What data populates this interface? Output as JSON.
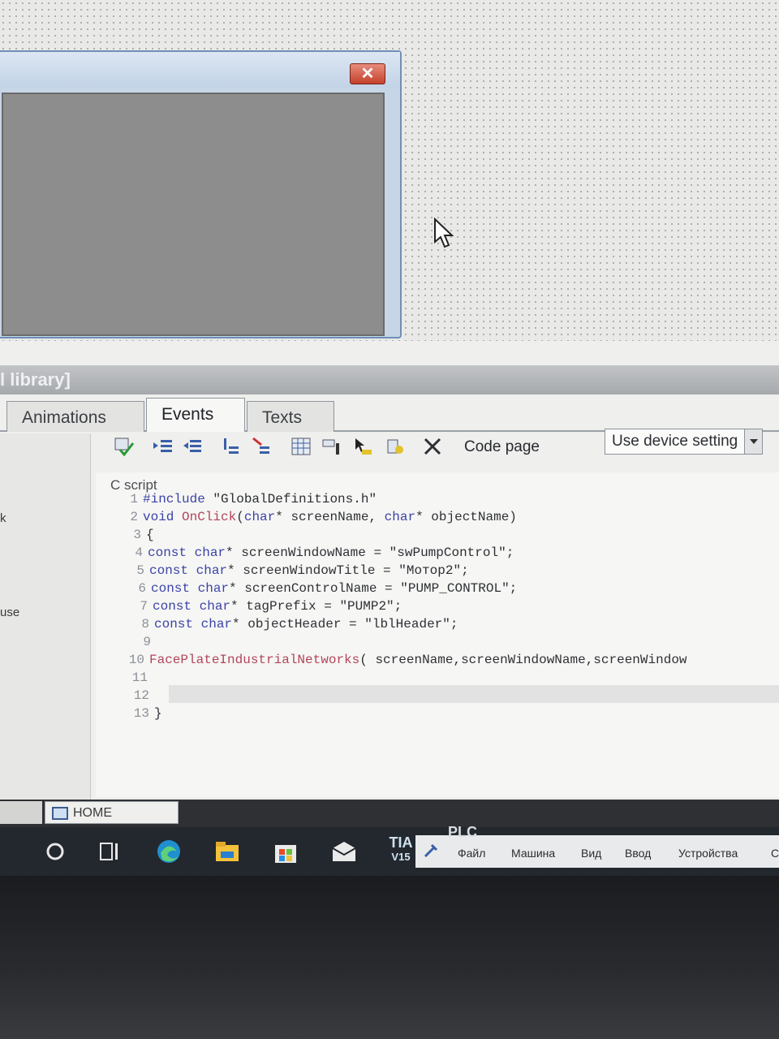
{
  "window": {
    "close_glyph": "✕"
  },
  "panel": {
    "header_text": "l library]",
    "tabs": [
      {
        "label": "Animations"
      },
      {
        "label": "Events"
      },
      {
        "label": "Texts"
      }
    ],
    "left_labels": [
      "k",
      "use"
    ],
    "toolbar": {
      "code_page_label": "Code page",
      "code_page_value": "Use device setting"
    },
    "editor": {
      "label": "C script",
      "lines": [
        {
          "n": "1",
          "parts": [
            [
              "pp",
              "#include "
            ],
            [
              "str",
              "\"GlobalDefinitions.h\""
            ]
          ]
        },
        {
          "n": "2",
          "parts": [
            [
              "kw",
              "void "
            ],
            [
              "fn",
              "OnClick"
            ],
            [
              "",
              "("
            ],
            [
              "kw",
              "char"
            ],
            [
              "",
              "* screenName, "
            ],
            [
              "kw",
              "char"
            ],
            [
              "",
              "* objectName)"
            ]
          ]
        },
        {
          "n": "3",
          "parts": [
            [
              "",
              "{"
            ]
          ]
        },
        {
          "n": "4",
          "parts": [
            [
              "kw",
              "const char"
            ],
            [
              "",
              "* screenWindowName = "
            ],
            [
              "str",
              "\"swPumpControl\""
            ],
            [
              "",
              ";"
            ]
          ]
        },
        {
          "n": "5",
          "parts": [
            [
              "kw",
              "const char"
            ],
            [
              "",
              "* screenWindowTitle = "
            ],
            [
              "str",
              "\"Мотор2\""
            ],
            [
              "",
              ";"
            ]
          ]
        },
        {
          "n": "6",
          "parts": [
            [
              "kw",
              "const char"
            ],
            [
              "",
              "* screenControlName = "
            ],
            [
              "str",
              "\"PUMP_CONTROL\""
            ],
            [
              "",
              ";"
            ]
          ]
        },
        {
          "n": "7",
          "parts": [
            [
              "kw",
              "const char"
            ],
            [
              "",
              "* tagPrefix = "
            ],
            [
              "str",
              "\"PUMP2\""
            ],
            [
              "",
              ";"
            ]
          ]
        },
        {
          "n": "8",
          "parts": [
            [
              "kw",
              "const char"
            ],
            [
              "",
              "* objectHeader = "
            ],
            [
              "str",
              "\"lblHeader\""
            ],
            [
              "",
              ";"
            ]
          ]
        },
        {
          "n": "9",
          "parts": []
        },
        {
          "n": "10",
          "parts": [
            [
              "fn",
              "FacePlateIndustrialNetworks"
            ],
            [
              "",
              "( screenName,screenWindowName,screenWindow"
            ]
          ]
        },
        {
          "n": "11",
          "parts": []
        },
        {
          "n": "12",
          "parts": []
        },
        {
          "n": "13",
          "parts": [
            [
              "",
              "}"
            ]
          ]
        }
      ]
    }
  },
  "status_bar": {
    "home_label": "HOME"
  },
  "taskbar": {
    "tia_label": "TIA",
    "tia_version": "V15",
    "plc_title": "PLC",
    "plc_menu": [
      "Файл",
      "Машина",
      "Вид",
      "Ввод",
      "Устройства",
      "С"
    ]
  },
  "colors": {
    "keyword": "#3b43a8",
    "function": "#b2455a",
    "close_button": "#c4412c",
    "taskbar": "#23272e"
  },
  "icons": [
    "close-icon",
    "mouse-cursor-icon",
    "compile-icon",
    "indent-icon",
    "outdent-icon",
    "comment-icon",
    "uncomment-icon",
    "grid-icon",
    "tag-icon",
    "pointer-icon",
    "bookmark-icon",
    "delete-icon",
    "search-icon",
    "task-view-icon",
    "edge-icon",
    "file-explorer-icon",
    "store-icon",
    "mail-icon"
  ]
}
